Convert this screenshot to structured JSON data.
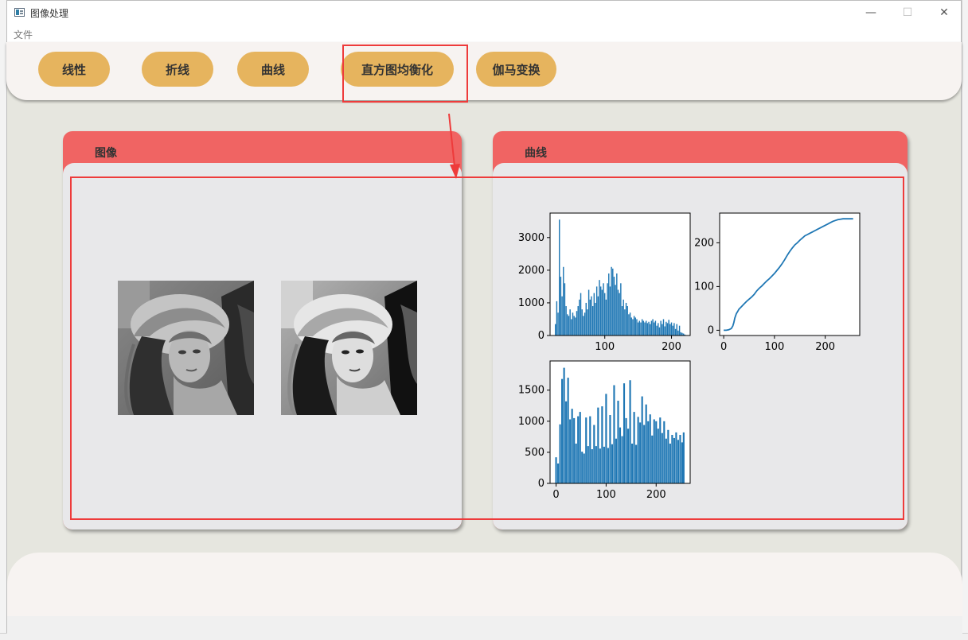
{
  "window": {
    "title": "图像处理",
    "controls": {
      "minimize": "—",
      "maximize": "☐",
      "close": "✕"
    }
  },
  "menu": {
    "file": "文件"
  },
  "toolbar": {
    "buttons": [
      {
        "label": "线性"
      },
      {
        "label": "折线"
      },
      {
        "label": "曲线"
      },
      {
        "label": "直方图均衡化"
      },
      {
        "label": "伽马变换"
      }
    ]
  },
  "panels": {
    "image": {
      "title": "图像"
    },
    "curve": {
      "title": "曲线"
    }
  },
  "colors": {
    "button": "#e6b45e",
    "panel_header": "#f06463",
    "panel_body": "#e8e8ea",
    "toolbar": "#f7f3f1",
    "annotation": "#ee3b3b",
    "plot_series": "#1f77b4"
  },
  "chart_data": [
    {
      "type": "bar",
      "xlim": [
        18,
        228
      ],
      "ylim": [
        0,
        3750
      ],
      "xticks": [
        100,
        200
      ],
      "yticks": [
        0,
        1000,
        2000,
        3000
      ],
      "x": [
        26,
        28,
        30,
        32,
        34,
        36,
        38,
        40,
        42,
        44,
        46,
        48,
        50,
        52,
        54,
        56,
        58,
        60,
        62,
        64,
        66,
        68,
        70,
        72,
        74,
        76,
        78,
        80,
        82,
        84,
        86,
        88,
        90,
        92,
        94,
        96,
        98,
        100,
        102,
        104,
        106,
        108,
        110,
        112,
        114,
        116,
        118,
        120,
        122,
        124,
        126,
        128,
        130,
        132,
        134,
        136,
        138,
        140,
        142,
        144,
        146,
        148,
        150,
        152,
        154,
        156,
        158,
        160,
        162,
        164,
        166,
        168,
        170,
        172,
        174,
        176,
        178,
        180,
        182,
        184,
        186,
        188,
        190,
        192,
        194,
        196,
        198,
        200,
        202,
        204,
        206,
        208,
        210,
        212,
        214,
        216,
        218,
        220,
        222
      ],
      "values": [
        350,
        1050,
        700,
        3550,
        1800,
        1200,
        2100,
        1600,
        900,
        650,
        600,
        800,
        500,
        700,
        600,
        550,
        750,
        900,
        1100,
        1300,
        800,
        600,
        700,
        1000,
        800,
        1400,
        1100,
        1200,
        900,
        1300,
        1000,
        1500,
        1200,
        1700,
        1500,
        1400,
        1600,
        1300,
        1100,
        1600,
        1900,
        1500,
        2100,
        2050,
        1800,
        1550,
        1900,
        1400,
        1300,
        1600,
        900,
        1100,
        800,
        1000,
        900,
        650,
        700,
        550,
        500,
        600,
        550,
        500,
        400,
        450,
        400,
        500,
        450,
        400,
        450,
        380,
        420,
        350,
        450,
        500,
        400,
        450,
        300,
        380,
        250,
        450,
        350,
        500,
        280,
        420,
        380,
        480,
        350,
        400,
        300,
        380,
        200,
        350,
        150,
        300,
        100,
        80,
        60,
        30,
        10
      ]
    },
    {
      "type": "line",
      "xlim": [
        -8,
        268
      ],
      "ylim": [
        -12,
        268
      ],
      "xticks": [
        0,
        100,
        200
      ],
      "yticks": [
        0,
        100,
        200
      ],
      "x": [
        0,
        5,
        10,
        15,
        18,
        20,
        22,
        25,
        28,
        30,
        35,
        40,
        45,
        50,
        55,
        60,
        65,
        70,
        75,
        80,
        85,
        90,
        95,
        100,
        105,
        110,
        115,
        120,
        125,
        130,
        135,
        140,
        145,
        150,
        155,
        160,
        165,
        170,
        175,
        180,
        185,
        190,
        195,
        200,
        205,
        210,
        215,
        220,
        225,
        230,
        235,
        240,
        245,
        250,
        255
      ],
      "y": [
        0,
        0,
        1,
        4,
        10,
        18,
        28,
        38,
        44,
        48,
        54,
        60,
        66,
        71,
        76,
        82,
        90,
        96,
        101,
        107,
        113,
        118,
        124,
        130,
        137,
        144,
        152,
        161,
        171,
        180,
        188,
        195,
        200,
        206,
        211,
        216,
        219,
        222,
        225,
        228,
        231,
        234,
        237,
        240,
        243,
        246,
        249,
        251,
        253,
        254,
        255,
        255,
        255,
        255,
        255
      ]
    },
    {
      "type": "bar",
      "xlim": [
        -12,
        268
      ],
      "ylim": [
        0,
        1970
      ],
      "xticks": [
        0,
        100,
        200
      ],
      "yticks": [
        0,
        500,
        1000,
        1500
      ],
      "x": [
        0,
        4,
        8,
        12,
        16,
        20,
        24,
        28,
        32,
        36,
        40,
        44,
        48,
        52,
        56,
        60,
        64,
        68,
        72,
        76,
        80,
        84,
        88,
        92,
        96,
        100,
        104,
        108,
        112,
        116,
        120,
        124,
        128,
        132,
        136,
        140,
        144,
        148,
        152,
        156,
        160,
        164,
        168,
        172,
        176,
        180,
        184,
        188,
        192,
        196,
        200,
        204,
        208,
        212,
        216,
        220,
        224,
        228,
        232,
        236,
        240,
        244,
        248,
        252,
        255
      ],
      "values": [
        420,
        320,
        950,
        1680,
        1860,
        1320,
        1700,
        1030,
        1200,
        1050,
        640,
        1080,
        1150,
        510,
        480,
        1060,
        600,
        1080,
        550,
        940,
        600,
        1220,
        560,
        1240,
        590,
        1440,
        570,
        1100,
        630,
        1580,
        720,
        1330,
        900,
        760,
        1610,
        1050,
        880,
        1660,
        640,
        1150,
        620,
        1070,
        980,
        1400,
        940,
        1270,
        1000,
        1110,
        770,
        1030,
        1000,
        880,
        1060,
        810,
        1000,
        720,
        860,
        640,
        780,
        730,
        820,
        700,
        780,
        660,
        820
      ]
    }
  ]
}
